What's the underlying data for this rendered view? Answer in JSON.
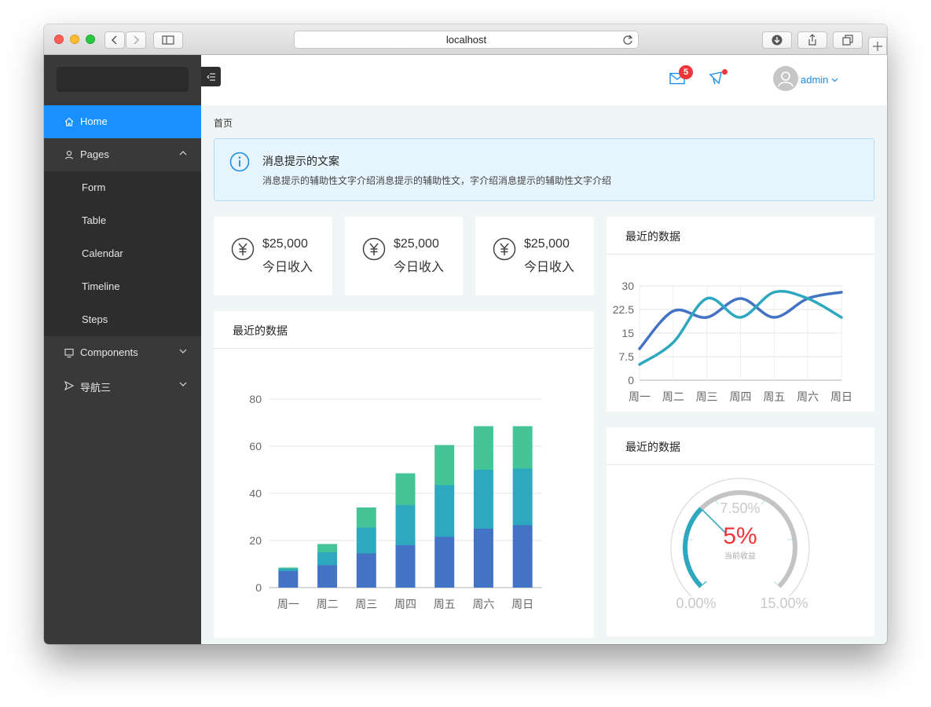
{
  "browser": {
    "address": "localhost"
  },
  "sidebar": {
    "menu": [
      {
        "label": "Home",
        "icon": "home-icon",
        "active": true
      },
      {
        "label": "Pages",
        "icon": "user-icon",
        "expanded": true
      },
      {
        "label": "Components",
        "icon": "monitor-icon"
      },
      {
        "label": "导航三",
        "icon": "send-icon"
      }
    ],
    "pages_children": [
      "Form",
      "Table",
      "Calendar",
      "Timeline",
      "Steps"
    ]
  },
  "header": {
    "mail_count": "5",
    "username": "admin"
  },
  "breadcrumb": "首页",
  "alert": {
    "title": "消息提示的文案",
    "description": "消息提示的辅助性文字介绍消息提示的辅助性文，字介绍消息提示的辅助性文字介绍"
  },
  "stats": [
    {
      "value": "$25,000",
      "label": "今日收入"
    },
    {
      "value": "$25,000",
      "label": "今日收入"
    },
    {
      "value": "$25,000",
      "label": "今日收入"
    }
  ],
  "colors": {
    "accent": "#1890ff",
    "series1": "#4472c4",
    "series2": "#2ea8bf",
    "series3": "#45c597",
    "danger": "#f0353a"
  },
  "chart_data": [
    {
      "type": "bar",
      "stacked": true,
      "title": "最近的数据",
      "categories": [
        "周一",
        "周二",
        "周三",
        "周四",
        "周五",
        "周六",
        "周日"
      ],
      "series": [
        {
          "values": [
            7,
            9.5,
            14.5,
            18,
            21.5,
            25,
            26.5
          ]
        },
        {
          "values": [
            1,
            5.5,
            11,
            17,
            22,
            25,
            24
          ]
        },
        {
          "values": [
            0.5,
            3.5,
            8.5,
            13.5,
            17,
            18.5,
            18
          ]
        }
      ],
      "ylim": [
        0,
        80
      ],
      "yticks": [
        0,
        20,
        40,
        60,
        80
      ],
      "grid": true
    },
    {
      "type": "line",
      "title": "最近的数据",
      "categories": [
        "周一",
        "周二",
        "周三",
        "周四",
        "周五",
        "周六",
        "周日"
      ],
      "series": [
        {
          "values": [
            10,
            22,
            20,
            26,
            20,
            26,
            28
          ]
        },
        {
          "values": [
            5,
            12,
            26,
            20,
            28,
            26,
            20
          ]
        }
      ],
      "ylim": [
        0,
        30
      ],
      "yticks": [
        "0",
        "7.5",
        "15",
        "22.5",
        "30"
      ],
      "grid": true
    },
    {
      "type": "gauge",
      "title": "最近的数据",
      "value_label": "5%",
      "value": 5,
      "center_caption": "当前收益",
      "min_label": "0.00%",
      "mid_label": "7.50%",
      "max_label": "15.00%",
      "min": 0,
      "max": 15
    }
  ]
}
